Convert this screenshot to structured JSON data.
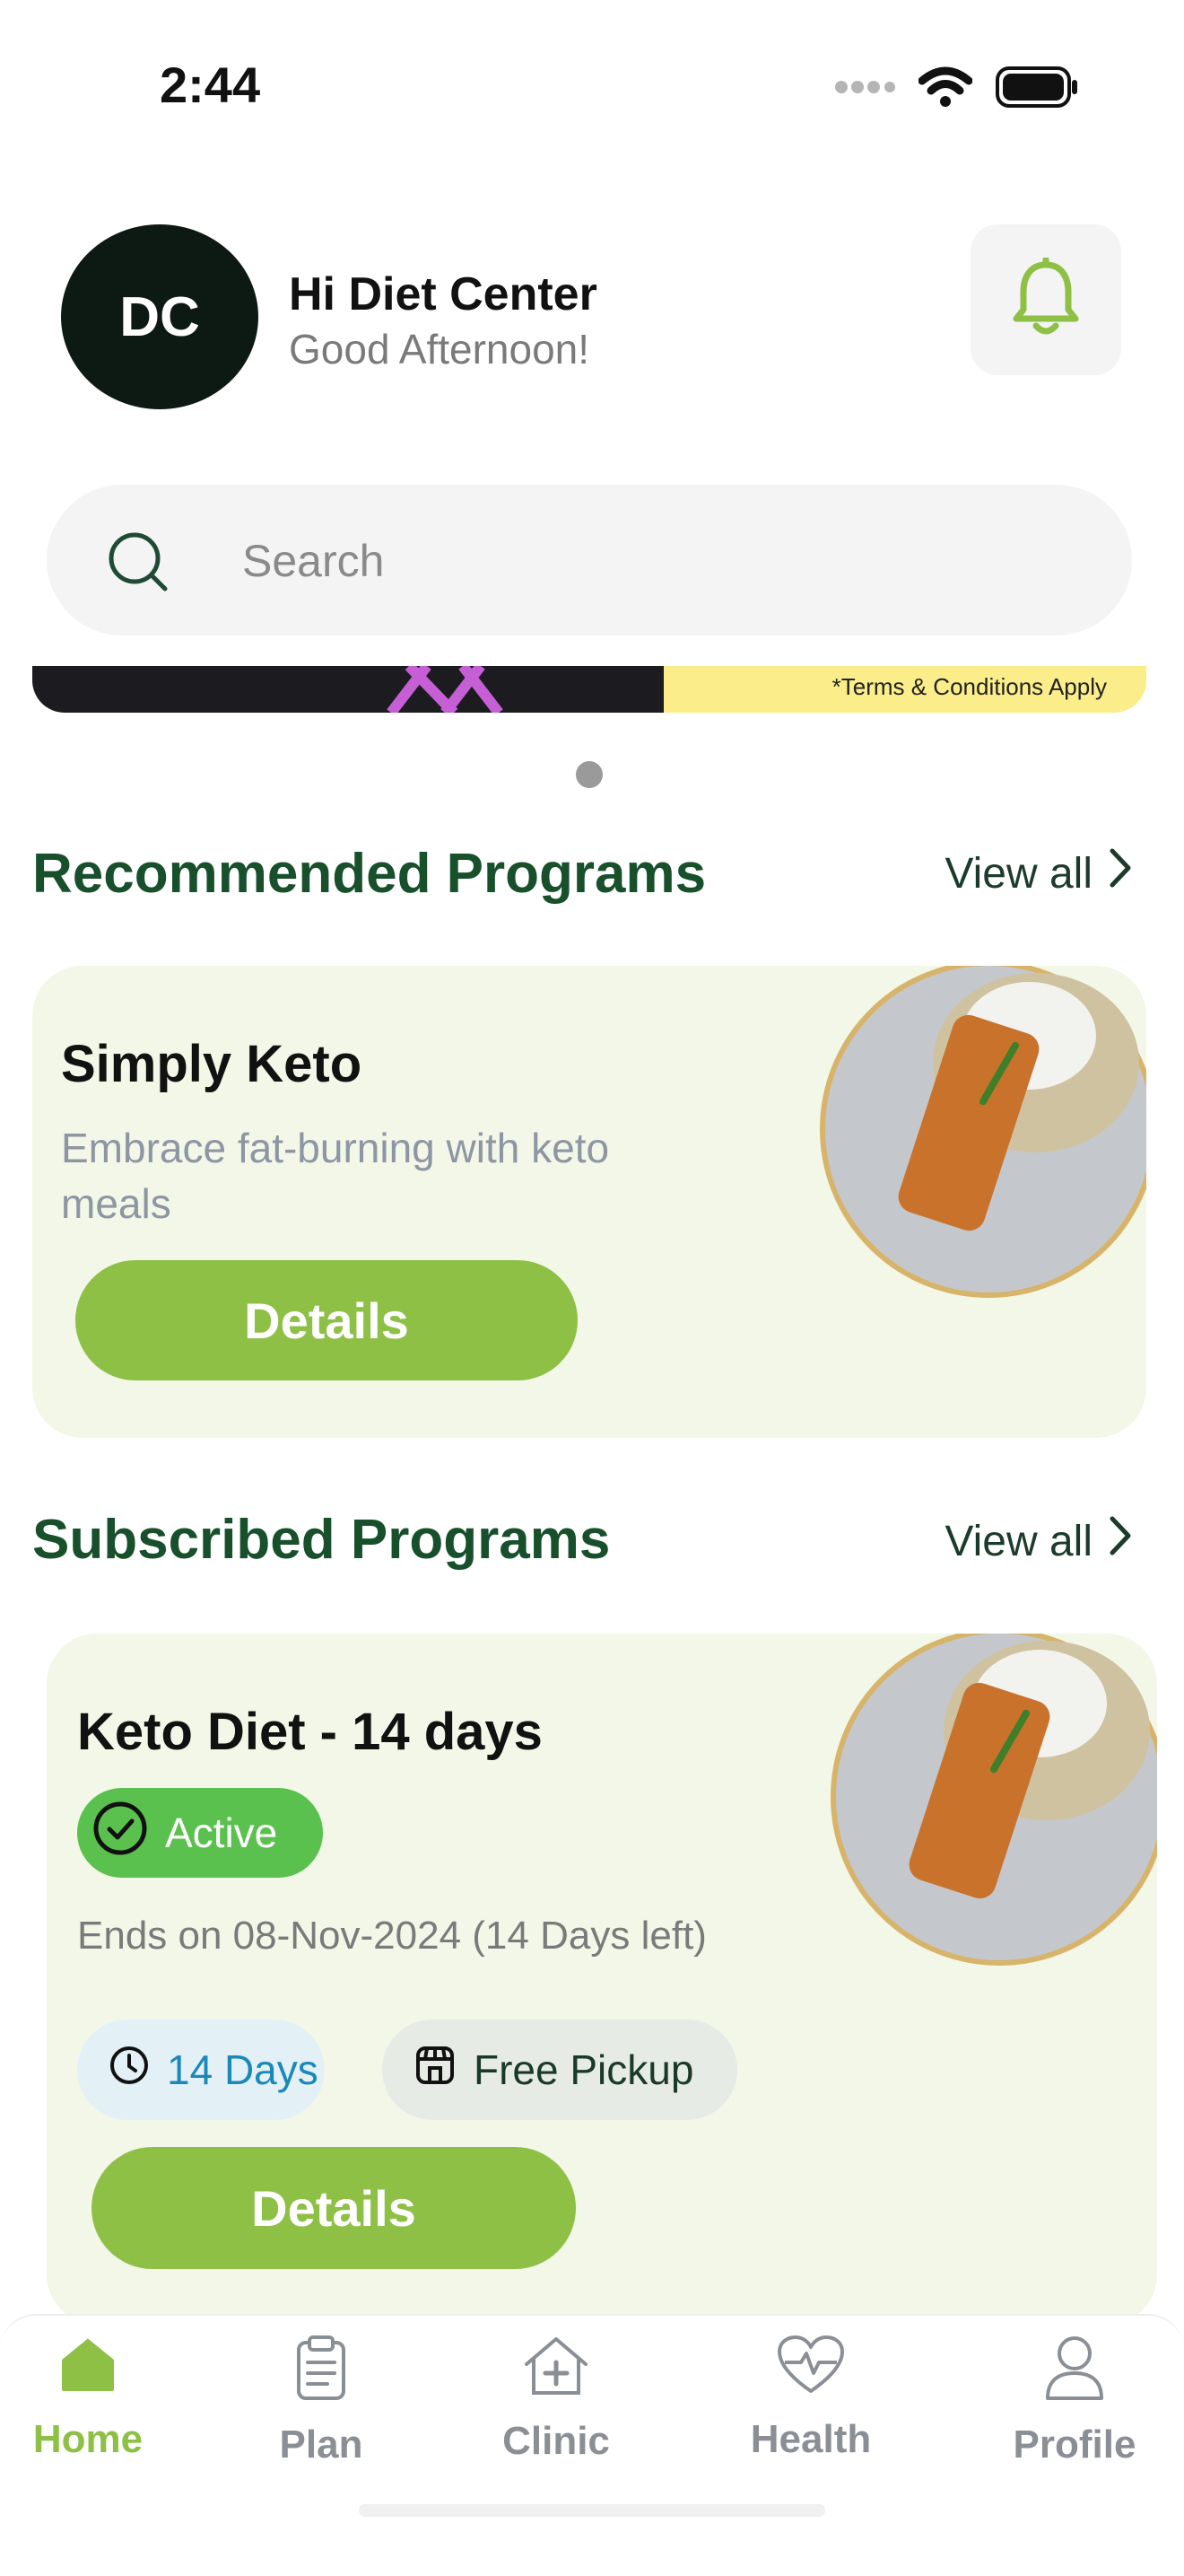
{
  "status_bar": {
    "time": "2:44"
  },
  "header": {
    "avatar_initials": "DC",
    "greeting_name": "Hi Diet Center",
    "greeting_sub": "Good Afternoon!"
  },
  "search": {
    "placeholder": "Search"
  },
  "banner": {
    "terms": "*Terms & Conditions Apply"
  },
  "recommended": {
    "title": "Recommended Programs",
    "view_all": "View all",
    "card": {
      "title": "Simply Keto",
      "description": "Embrace fat-burning with keto meals",
      "button": "Details"
    }
  },
  "subscribed": {
    "title": "Subscribed Programs",
    "view_all": "View all",
    "card": {
      "title": "Keto Diet - 14 days",
      "status": "Active",
      "ends": "Ends on 08-Nov-2024 (14 Days left)",
      "chip_days": "14 Days",
      "chip_pickup": "Free Pickup",
      "button": "Details"
    }
  },
  "tabbar": {
    "home": "Home",
    "plan": "Plan",
    "clinic": "Clinic",
    "health": "Health",
    "profile": "Profile"
  },
  "colors": {
    "accent": "#8dc045",
    "title_green": "#17502b",
    "card_bg": "#f2f7e8",
    "active_green": "#5ac14e"
  },
  "icons": [
    "signal-icon",
    "wifi-icon",
    "battery-icon",
    "bell-icon",
    "search-icon",
    "chevron-right-icon",
    "check-circle-icon",
    "clock-icon",
    "store-icon",
    "home-icon",
    "clipboard-icon",
    "clinic-icon",
    "heart-pulse-icon",
    "user-icon"
  ]
}
